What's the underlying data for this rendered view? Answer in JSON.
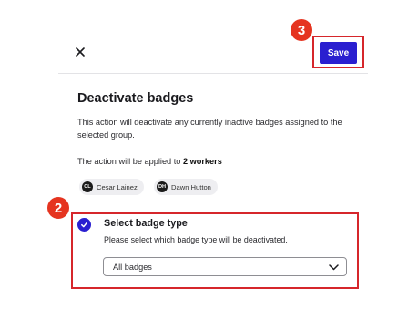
{
  "header": {
    "close_icon": "close-icon",
    "save_label": "Save",
    "accent": "#2a1fd0"
  },
  "markers": {
    "save_step": "3",
    "badge_type_step": "2",
    "color": "#e53420"
  },
  "dialog": {
    "title": "Deactivate badges",
    "description": "This action will deactivate any currently inactive badges assigned to the selected group.",
    "applied_prefix": "The action will be applied to ",
    "applied_count": "2 workers"
  },
  "workers": [
    {
      "initials": "CL",
      "name": "Cesar Lainez"
    },
    {
      "initials": "DH",
      "name": "Dawn Hutton"
    }
  ],
  "badge_type": {
    "title": "Select badge type",
    "subtitle": "Please select which badge type will be deactivated.",
    "selected": "All badges",
    "checked": true
  }
}
